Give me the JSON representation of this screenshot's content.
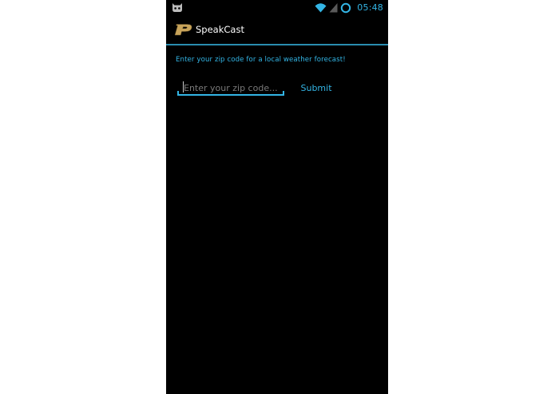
{
  "status_bar": {
    "time": "05:48",
    "notification_icon": "cyanogenmod-bot-icon",
    "wifi_icon": "wifi-icon",
    "signal_icon": "cell-signal-icon",
    "battery_icon": "battery-circle-icon"
  },
  "action_bar": {
    "title": "SpeakCast",
    "logo_icon": "purdue-p-logo"
  },
  "main": {
    "prompt": "Enter your zip code for a local weather forecast!",
    "zip_input": {
      "placeholder": "Enter your zip code...",
      "value": ""
    },
    "submit_label": "Submit"
  },
  "colors": {
    "accent": "#33b5e5",
    "background": "#000000",
    "logo_gold": "#c7a35a"
  }
}
